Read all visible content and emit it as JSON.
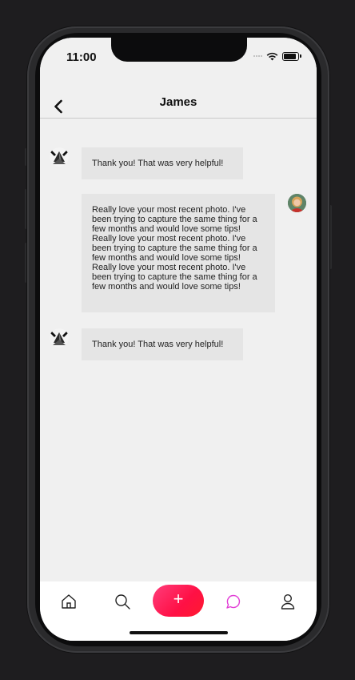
{
  "status_bar": {
    "time": "11:00"
  },
  "header": {
    "title": "James"
  },
  "messages": [
    {
      "side": "incoming",
      "text": "Thank you! That was very helpful!"
    },
    {
      "side": "outgoing",
      "text": "Really love your most recent photo. I've been trying to capture the same thing for a few months and would love some tips! Really love your most recent photo. I've been trying to capture the same thing for a few months and would love some tips! Really love your most recent photo. I've been trying to capture the same thing for a few months and would love some tips!"
    },
    {
      "side": "incoming",
      "text": "Thank you! That was very helpful!"
    }
  ],
  "tabbar": {
    "items": [
      "home-icon",
      "search-icon",
      "add-icon",
      "chat-icon",
      "profile-icon"
    ],
    "add_label": "+",
    "active": "chat-icon"
  },
  "colors": {
    "accent": "#ff1a4f",
    "active_tab": "#e23fd6",
    "bubble": "#e5e5e5",
    "background": "#f0f0f0"
  }
}
